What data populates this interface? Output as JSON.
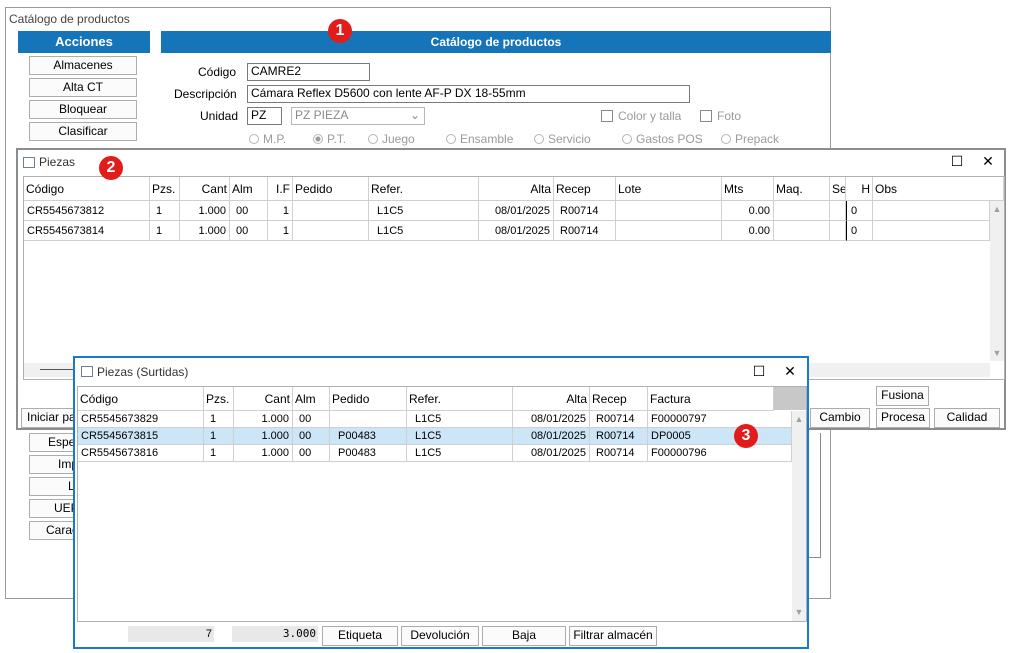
{
  "main": {
    "title": "Catálogo de productos",
    "acciones_header": "Acciones",
    "panel_header": "Catálogo de productos",
    "left_buttons": [
      "Almacenes",
      "Alta CT",
      "Bloquear",
      "Clasificar"
    ],
    "left_buttons_lower": [
      "Espe",
      "Imp",
      "L",
      "UEP",
      "Carac"
    ],
    "codigo_label": "Código",
    "codigo_value": "CAMRE2",
    "descripcion_label": "Descripción",
    "descripcion_value": "Cámara Reflex D5600 con lente AF-P DX 18-55mm",
    "unidad_label": "Unidad",
    "unidad_value": "PZ",
    "unidad_select": "PZ  PIEZA",
    "color_talla": "Color y talla",
    "foto": "Foto",
    "radios": [
      "M.P.",
      "P.T.",
      "Juego",
      "Ensamble",
      "Servicio",
      "Gastos POS",
      "Prepack"
    ],
    "selected_radio": "P.T."
  },
  "badges": [
    "1",
    "2",
    "3"
  ],
  "piezas": {
    "title": "Piezas",
    "columns": [
      "Código",
      "Pzs.",
      "Cant",
      "Alm",
      "I.F",
      "Pedido",
      "Refer.",
      "Alta",
      "Recep",
      "Lote",
      "Mts",
      "Maq.",
      "Se",
      "H",
      "Obs"
    ],
    "rows": [
      {
        "codigo": "CR5545673812",
        "pzs": "1",
        "cant": "1.000",
        "alm": "00",
        "if": "1",
        "pedido": "",
        "refer": "L1C5",
        "alta": "08/01/2025",
        "recep": "R00714",
        "lote": "",
        "mts": "0.00",
        "maq": "",
        "se": "",
        "h": "0",
        "obs": ""
      },
      {
        "codigo": "CR5545673814",
        "pzs": "1",
        "cant": "1.000",
        "alm": "00",
        "if": "1",
        "pedido": "",
        "refer": "L1C5",
        "alta": "08/01/2025",
        "recep": "R00714",
        "lote": "",
        "mts": "0.00",
        "maq": "",
        "se": "",
        "h": "0",
        "obs": ""
      }
    ],
    "buttons": {
      "fusiona": "Fusiona",
      "cambio": "Cambio",
      "procesa": "Procesa",
      "calidad": "Calidad",
      "iniciar": "Iniciar pa"
    }
  },
  "surtidas": {
    "title": "Piezas (Surtidas)",
    "columns": [
      "Código",
      "Pzs.",
      "Cant",
      "Alm",
      "Pedido",
      "Refer.",
      "Alta",
      "Recep",
      "Factura"
    ],
    "rows": [
      {
        "codigo": "CR5545673829",
        "pzs": "1",
        "cant": "1.000",
        "alm": "00",
        "pedido": "",
        "refer": "L1C5",
        "alta": "08/01/2025",
        "recep": "R00714",
        "factura": "F00000797"
      },
      {
        "codigo": "CR5545673815",
        "pzs": "1",
        "cant": "1.000",
        "alm": "00",
        "pedido": "P00483",
        "refer": "L1C5",
        "alta": "08/01/2025",
        "recep": "R00714",
        "factura": "DP0005"
      },
      {
        "codigo": "CR5545673816",
        "pzs": "1",
        "cant": "1.000",
        "alm": "00",
        "pedido": "P00483",
        "refer": "L1C5",
        "alta": "08/01/2025",
        "recep": "R00714",
        "factura": "F00000796"
      }
    ],
    "selected_row": 1,
    "total_pzs": "7",
    "total_cant": "3.000",
    "buttons": {
      "etiqueta": "Etiqueta",
      "devolucion": "Devolución",
      "baja": "Baja",
      "filtrar": "Filtrar almacén"
    }
  },
  "colors": {
    "accent": "#1575b8",
    "badge": "#e21b1b",
    "selected_row": "#cde6f7",
    "surtidas_border": "#1979ca"
  },
  "icons": [
    "window-icon",
    "maximize-icon",
    "close-icon",
    "chevron-down-icon",
    "scroll-up-icon",
    "scroll-down-icon"
  ]
}
